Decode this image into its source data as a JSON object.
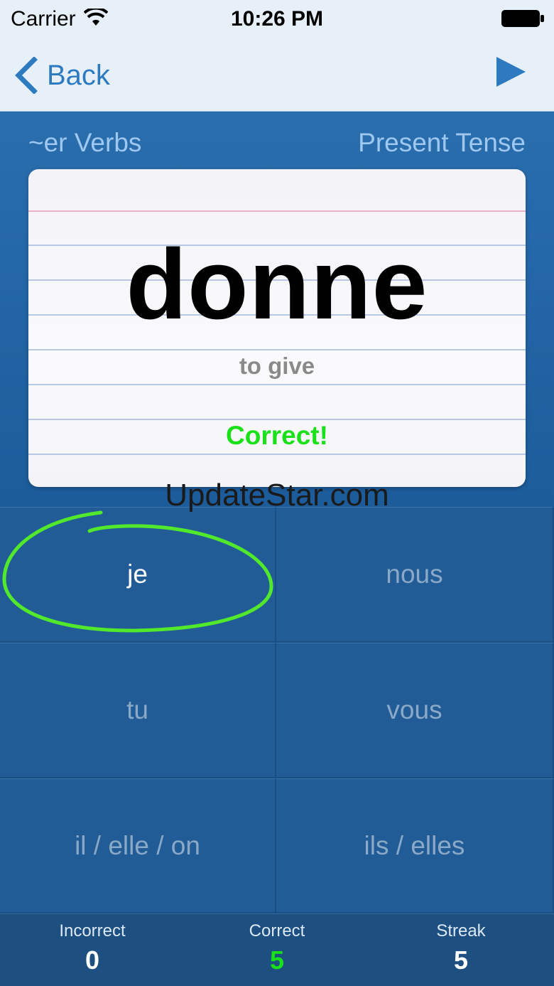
{
  "status_bar": {
    "carrier": "Carrier",
    "time": "10:26 PM"
  },
  "nav": {
    "back_label": "Back",
    "play_icon": "play-triangle-icon"
  },
  "header": {
    "verb_group": "~er Verbs",
    "tense": "Present Tense"
  },
  "card": {
    "word": "donne",
    "translation": "to give",
    "result": "Correct!",
    "result_color": "#19e019"
  },
  "watermark": "UpdateStar.com",
  "pronouns": [
    {
      "label": "je",
      "selected": true
    },
    {
      "label": "nous",
      "selected": false
    },
    {
      "label": "tu",
      "selected": false
    },
    {
      "label": "vous",
      "selected": false
    },
    {
      "label": "il / elle / on",
      "selected": false
    },
    {
      "label": "ils / elles",
      "selected": false
    }
  ],
  "stats": {
    "incorrect_label": "Incorrect",
    "incorrect_value": "0",
    "correct_label": "Correct",
    "correct_value": "5",
    "streak_label": "Streak",
    "streak_value": "5"
  },
  "colors": {
    "accent": "#2e7ac0",
    "background": "#1f64a6",
    "highlight": "#19e019"
  }
}
